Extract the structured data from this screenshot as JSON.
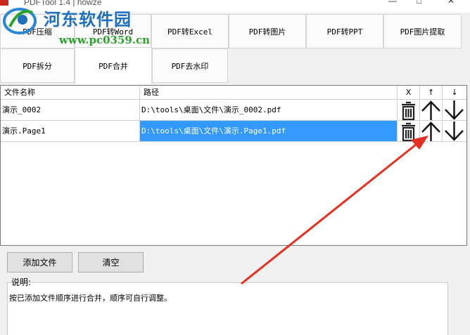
{
  "window": {
    "title": "PDFTool 1.4 | howze",
    "minimize_glyph": "—",
    "maximize_glyph": "□",
    "close_glyph": "✕"
  },
  "watermark": {
    "title": "河东软件园",
    "url": "www.pc0359.cn"
  },
  "tabs": [
    {
      "label": "PDF压缩"
    },
    {
      "label": "PDF转Word"
    },
    {
      "label": "PDF转Excel"
    },
    {
      "label": "PDF转图片"
    },
    {
      "label": "PDF转PPT"
    },
    {
      "label": "PDF图片提取"
    },
    {
      "label": "PDF拆分"
    },
    {
      "label": "PDF合并",
      "active": true
    },
    {
      "label": "PDF去水印"
    }
  ],
  "table": {
    "columns": [
      "文件名称",
      "路径",
      "X",
      "↑",
      "↓"
    ],
    "rows": [
      {
        "name": "演示_0002",
        "path": "D:\\tools\\桌面\\文件\\演示_0002.pdf",
        "selected": false
      },
      {
        "name": "演示.Page1",
        "path": "D:\\tools\\桌面\\文件\\演示.Page1.pdf",
        "selected": true
      }
    ],
    "icons": {
      "delete": "trash-icon",
      "up": "arrow-up-icon",
      "down": "arrow-down-icon"
    }
  },
  "buttons": {
    "add_files": "添加文件",
    "clear": "清空"
  },
  "description": {
    "label": "说明:",
    "text": "按已添加文件顺序进行合并，顺序可自行调整。"
  },
  "colors": {
    "selection": "#3399ff",
    "annotation_arrow": "#e53020",
    "watermark_blue": "#1f6fbf",
    "watermark_green": "#2aa12a"
  }
}
